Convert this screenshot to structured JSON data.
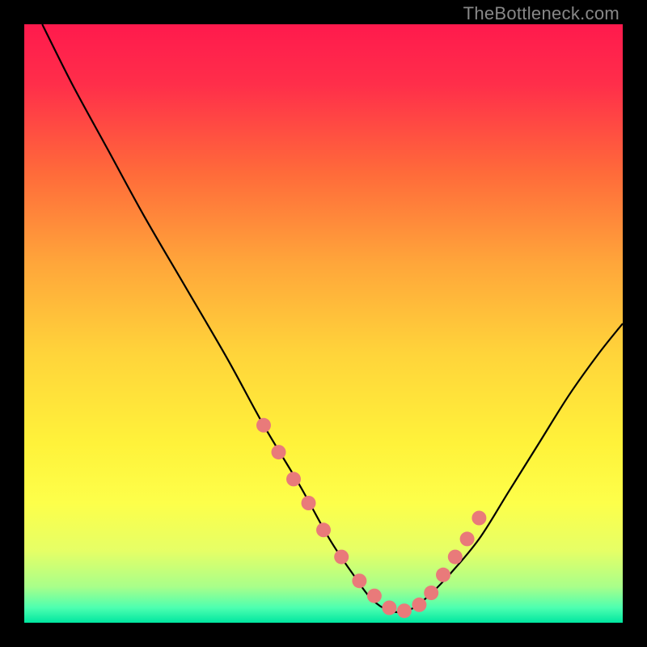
{
  "watermark": "TheBottleneck.com",
  "chart_data": {
    "type": "line",
    "title": "",
    "xlabel": "",
    "ylabel": "",
    "xlim": [
      0,
      100
    ],
    "ylim": [
      0,
      100
    ],
    "background_gradient_stops": [
      {
        "pos": 0.0,
        "color": "#ff1a4d"
      },
      {
        "pos": 0.1,
        "color": "#ff2e4a"
      },
      {
        "pos": 0.25,
        "color": "#ff6b3a"
      },
      {
        "pos": 0.4,
        "color": "#ffa63a"
      },
      {
        "pos": 0.55,
        "color": "#ffd43a"
      },
      {
        "pos": 0.7,
        "color": "#fff23a"
      },
      {
        "pos": 0.8,
        "color": "#fdff4a"
      },
      {
        "pos": 0.88,
        "color": "#e6ff66"
      },
      {
        "pos": 0.94,
        "color": "#a8ff8a"
      },
      {
        "pos": 0.975,
        "color": "#4dffb0"
      },
      {
        "pos": 1.0,
        "color": "#00e6a0"
      }
    ],
    "series": [
      {
        "name": "bottleneck-curve",
        "x": [
          3,
          8,
          14,
          20,
          27,
          34,
          40,
          46,
          51,
          55,
          58,
          61,
          64,
          67,
          71,
          76,
          81,
          86,
          91,
          96,
          100
        ],
        "y": [
          100,
          90,
          79,
          68,
          56,
          44,
          33,
          23,
          14,
          8,
          4,
          2,
          2,
          4,
          8,
          14,
          22,
          30,
          38,
          45,
          50
        ]
      }
    ],
    "marker_points": {
      "name": "highlight-dots",
      "color": "#e97a7a",
      "x": [
        40,
        42.5,
        45,
        47.5,
        50,
        53,
        56,
        58.5,
        61,
        63.5,
        66,
        68,
        70,
        72,
        74,
        76
      ],
      "y": [
        33,
        28.5,
        24,
        20,
        15.5,
        11,
        7,
        4.5,
        2.5,
        2,
        3,
        5,
        8,
        11,
        14,
        17.5
      ]
    }
  }
}
